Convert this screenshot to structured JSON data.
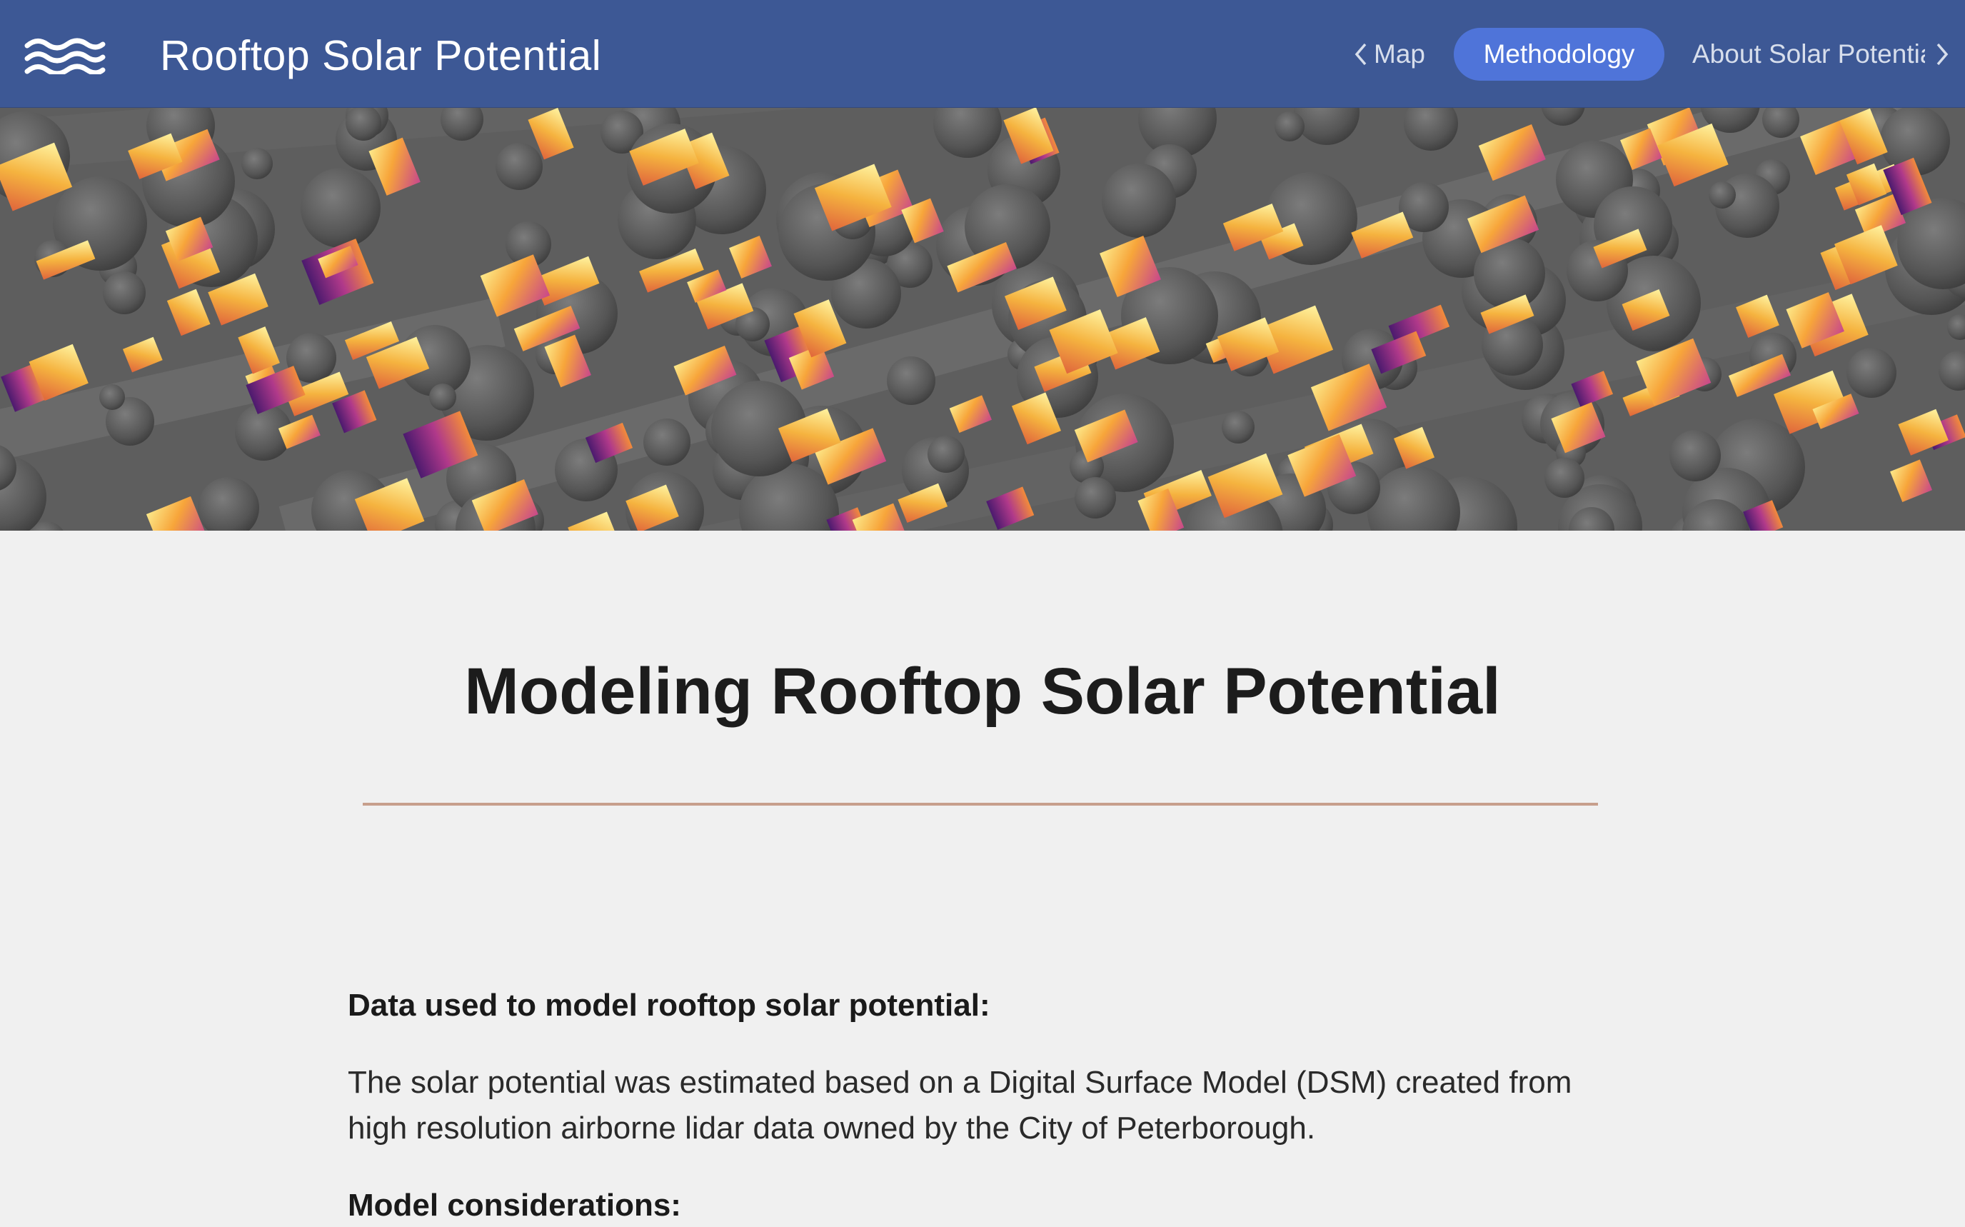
{
  "header": {
    "title": "Rooftop Solar Potential",
    "logo_icon": "waves-icon",
    "nav": {
      "prev_label": "Map",
      "active_label": "Methodology",
      "next_label": "About Solar Potentia"
    }
  },
  "colors": {
    "header_bg": "#3d5895",
    "active_pill": "#4f74d9",
    "divider": "#c79f8c",
    "page_bg": "#f0f0f0"
  },
  "main": {
    "title": "Modeling Rooftop Solar Potential",
    "sections": [
      {
        "heading": "Data used to model rooftop solar potential:",
        "body": "The solar potential was estimated based on a Digital Surface Model (DSM) created from high resolution airborne lidar data owned by the City of Peterborough."
      },
      {
        "heading": "Model considerations:"
      }
    ]
  }
}
